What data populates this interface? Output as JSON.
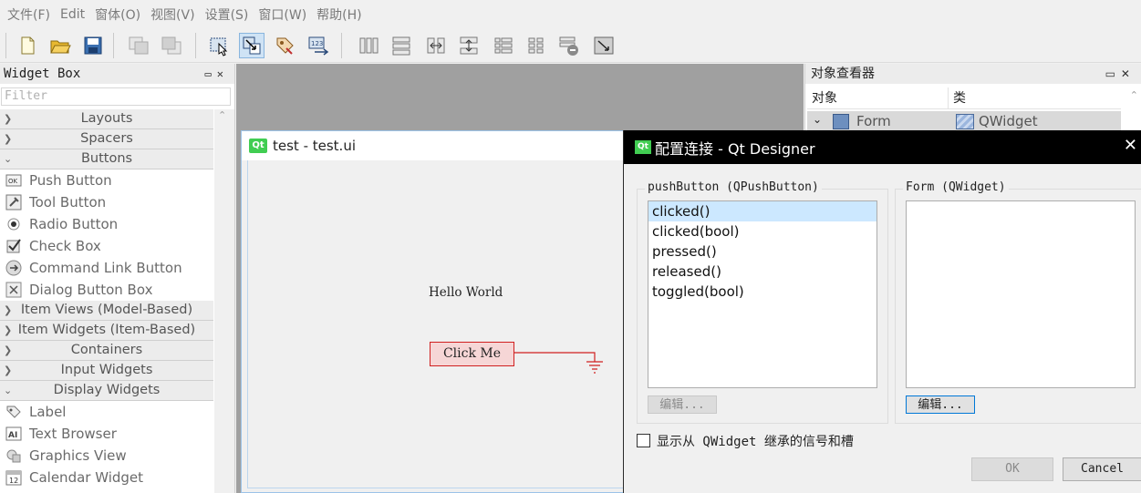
{
  "menubar": {
    "items": [
      "文件(F)",
      "Edit",
      "窗体(O)",
      "视图(V)",
      "设置(S)",
      "窗口(W)",
      "帮助(H)"
    ]
  },
  "toolbar": {
    "icons": [
      "new-file-icon",
      "open-folder-icon",
      "save-icon",
      "send-to-back-icon",
      "bring-to-front-icon",
      "edit-widgets-icon",
      "edit-signals-slots-icon",
      "edit-buddies-icon",
      "edit-tab-order-icon",
      "layout-horizontal-icon",
      "layout-vertical-icon",
      "layout-horizontal-splitter-icon",
      "layout-vertical-splitter-icon",
      "layout-form-icon",
      "layout-grid-icon",
      "break-layout-icon",
      "adjust-size-icon"
    ],
    "active": "edit-signals-slots-icon"
  },
  "widget_box": {
    "title": "Widget Box",
    "filter_placeholder": "Filter",
    "categories": {
      "layouts": "Layouts",
      "spacers": "Spacers",
      "buttons": "Buttons",
      "item_views": "Item Views (Model-Based)",
      "item_widgets": "Item Widgets (Item-Based)",
      "containers": "Containers",
      "input_widgets": "Input Widgets",
      "display_widgets": "Display Widgets"
    },
    "buttons_items": [
      "Push Button",
      "Tool Button",
      "Radio Button",
      "Check Box",
      "Command Link Button",
      "Dialog Button Box"
    ],
    "display_items": [
      "Label",
      "Text Browser",
      "Graphics View",
      "Calendar Widget"
    ]
  },
  "object_inspector": {
    "title": "对象查看器",
    "col_object": "对象",
    "col_class": "类",
    "row_object": "Form",
    "row_class": "QWidget"
  },
  "form_window": {
    "title": "test - test.ui",
    "label_text": "Hello World",
    "button_text": "Click Me"
  },
  "dialog": {
    "title": "配置连接 - Qt Designer",
    "sender_group": "pushButton (QPushButton)",
    "receiver_group": "Form (QWidget)",
    "signals": [
      "clicked()",
      "clicked(bool)",
      "pressed()",
      "released()",
      "toggled(bool)"
    ],
    "selected_signal": "clicked()",
    "edit_left": "编辑...",
    "edit_right": "编辑...",
    "show_inherited": "显示从 QWidget 继承的信号和槽",
    "ok": "OK",
    "cancel": "Cancel"
  },
  "colors": {
    "selection": "#cce8ff",
    "qt_green": "#41cd52",
    "connection_red": "#d02020"
  }
}
